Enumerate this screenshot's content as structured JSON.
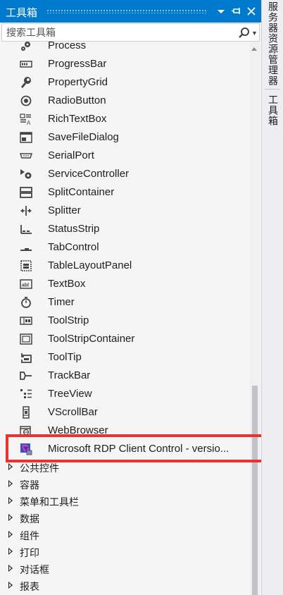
{
  "toolbox": {
    "title": "工具箱",
    "search_placeholder": "搜索工具箱",
    "buttons": {
      "dropdown": "▾",
      "pin": "⊣",
      "close": "✕"
    }
  },
  "items": [
    {
      "label": "Process",
      "icon": "gears-icon"
    },
    {
      "label": "ProgressBar",
      "icon": "progressbar-icon"
    },
    {
      "label": "PropertyGrid",
      "icon": "wrench-icon"
    },
    {
      "label": "RadioButton",
      "icon": "radio-icon"
    },
    {
      "label": "RichTextBox",
      "icon": "richtext-icon"
    },
    {
      "label": "SaveFileDialog",
      "icon": "save-dialog-icon"
    },
    {
      "label": "SerialPort",
      "icon": "serialport-icon"
    },
    {
      "label": "ServiceController",
      "icon": "service-icon"
    },
    {
      "label": "SplitContainer",
      "icon": "splitcontainer-icon"
    },
    {
      "label": "Splitter",
      "icon": "splitter-icon"
    },
    {
      "label": "StatusStrip",
      "icon": "statusstrip-icon"
    },
    {
      "label": "TabControl",
      "icon": "tabcontrol-icon"
    },
    {
      "label": "TableLayoutPanel",
      "icon": "tablelayout-icon"
    },
    {
      "label": "TextBox",
      "icon": "textbox-icon"
    },
    {
      "label": "Timer",
      "icon": "timer-icon"
    },
    {
      "label": "ToolStrip",
      "icon": "toolstrip-icon"
    },
    {
      "label": "ToolStripContainer",
      "icon": "toolstripcontainer-icon"
    },
    {
      "label": "ToolTip",
      "icon": "tooltip-icon"
    },
    {
      "label": "TrackBar",
      "icon": "trackbar-icon"
    },
    {
      "label": "TreeView",
      "icon": "treeview-icon"
    },
    {
      "label": "VScrollBar",
      "icon": "vscrollbar-icon"
    },
    {
      "label": "WebBrowser",
      "icon": "webbrowser-icon"
    },
    {
      "label": "Microsoft RDP Client Control - versio...",
      "icon": "rdp-client-icon"
    }
  ],
  "categories": [
    {
      "label": "公共控件"
    },
    {
      "label": "容器"
    },
    {
      "label": "菜单和工具栏"
    },
    {
      "label": "数据"
    },
    {
      "label": "组件"
    },
    {
      "label": "打印"
    },
    {
      "label": "对话框"
    },
    {
      "label": "报表"
    }
  ],
  "side_tabs": [
    "服务器资源管理器",
    "工具箱"
  ],
  "colors": {
    "accent": "#007acc",
    "highlight": "#e8332f",
    "background": "#f5f5f5"
  }
}
